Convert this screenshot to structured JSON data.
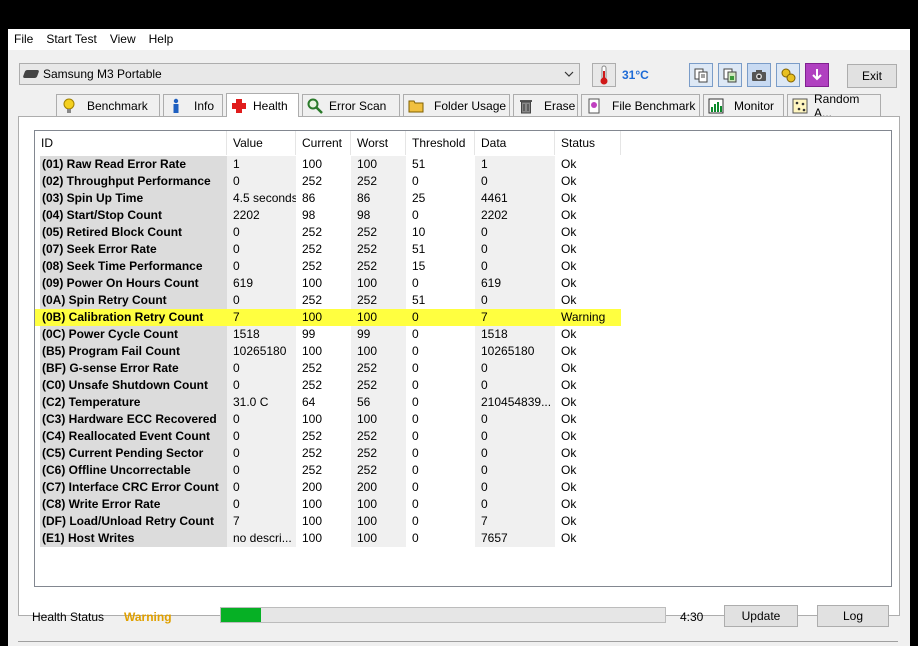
{
  "menu": [
    "File",
    "Start Test",
    "View",
    "Help"
  ],
  "toolbar": {
    "drive": "Samsung M3 Portable",
    "temperature": "31°C",
    "exit": "Exit"
  },
  "tabs": [
    {
      "label": "Benchmark",
      "icon": "lightbulb-icon"
    },
    {
      "label": "Info",
      "icon": "info-icon"
    },
    {
      "label": "Health",
      "icon": "health-cross-icon",
      "active": true
    },
    {
      "label": "Error Scan",
      "icon": "magnifier-icon"
    },
    {
      "label": "Folder Usage",
      "icon": "folder-icon"
    },
    {
      "label": "Erase",
      "icon": "trash-icon"
    },
    {
      "label": "File Benchmark",
      "icon": "file-benchmark-icon"
    },
    {
      "label": "Monitor",
      "icon": "monitor-chart-icon"
    },
    {
      "label": "Random A...",
      "icon": "random-access-icon"
    }
  ],
  "table": {
    "columns": [
      "ID",
      "Value",
      "Current",
      "Worst",
      "Threshold",
      "Data",
      "Status"
    ],
    "rows": [
      [
        "(01) Raw Read Error Rate",
        "1",
        "100",
        "100",
        "51",
        "1",
        "Ok"
      ],
      [
        "(02) Throughput Performance",
        "0",
        "252",
        "252",
        "0",
        "0",
        "Ok"
      ],
      [
        "(03) Spin Up Time",
        "4.5 seconds",
        "86",
        "86",
        "25",
        "4461",
        "Ok"
      ],
      [
        "(04) Start/Stop Count",
        "2202",
        "98",
        "98",
        "0",
        "2202",
        "Ok"
      ],
      [
        "(05) Retired Block Count",
        "0",
        "252",
        "252",
        "10",
        "0",
        "Ok"
      ],
      [
        "(07) Seek Error Rate",
        "0",
        "252",
        "252",
        "51",
        "0",
        "Ok"
      ],
      [
        "(08) Seek Time Performance",
        "0",
        "252",
        "252",
        "15",
        "0",
        "Ok"
      ],
      [
        "(09) Power On Hours Count",
        "619",
        "100",
        "100",
        "0",
        "619",
        "Ok"
      ],
      [
        "(0A) Spin Retry Count",
        "0",
        "252",
        "252",
        "51",
        "0",
        "Ok"
      ],
      [
        "(0B) Calibration Retry Count",
        "7",
        "100",
        "100",
        "0",
        "7",
        "Warning"
      ],
      [
        "(0C) Power Cycle Count",
        "1518",
        "99",
        "99",
        "0",
        "1518",
        "Ok"
      ],
      [
        "(B5) Program Fail Count",
        "10265180",
        "100",
        "100",
        "0",
        "10265180",
        "Ok"
      ],
      [
        "(BF) G-sense Error Rate",
        "0",
        "252",
        "252",
        "0",
        "0",
        "Ok"
      ],
      [
        "(C0) Unsafe Shutdown Count",
        "0",
        "252",
        "252",
        "0",
        "0",
        "Ok"
      ],
      [
        "(C2) Temperature",
        "31.0 C",
        "64",
        "56",
        "0",
        "210454839...",
        "Ok"
      ],
      [
        "(C3) Hardware ECC Recovered",
        "0",
        "100",
        "100",
        "0",
        "0",
        "Ok"
      ],
      [
        "(C4) Reallocated Event Count",
        "0",
        "252",
        "252",
        "0",
        "0",
        "Ok"
      ],
      [
        "(C5) Current Pending Sector",
        "0",
        "252",
        "252",
        "0",
        "0",
        "Ok"
      ],
      [
        "(C6) Offline Uncorrectable",
        "0",
        "252",
        "252",
        "0",
        "0",
        "Ok"
      ],
      [
        "(C7) Interface CRC Error Count",
        "0",
        "200",
        "200",
        "0",
        "0",
        "Ok"
      ],
      [
        "(C8) Write Error Rate",
        "0",
        "100",
        "100",
        "0",
        "0",
        "Ok"
      ],
      [
        "(DF) Load/Unload Retry Count",
        "7",
        "100",
        "100",
        "0",
        "7",
        "Ok"
      ],
      [
        "(E1) Host Writes",
        "no descri...",
        "100",
        "100",
        "0",
        "7657",
        "Ok"
      ]
    ],
    "warning_row_color": "#ffff40"
  },
  "status": {
    "label": "Health Status",
    "value": "Warning",
    "value_color": "#e0a000",
    "progress_fraction": 0.09,
    "time": "4:30",
    "update": "Update",
    "log": "Log"
  }
}
